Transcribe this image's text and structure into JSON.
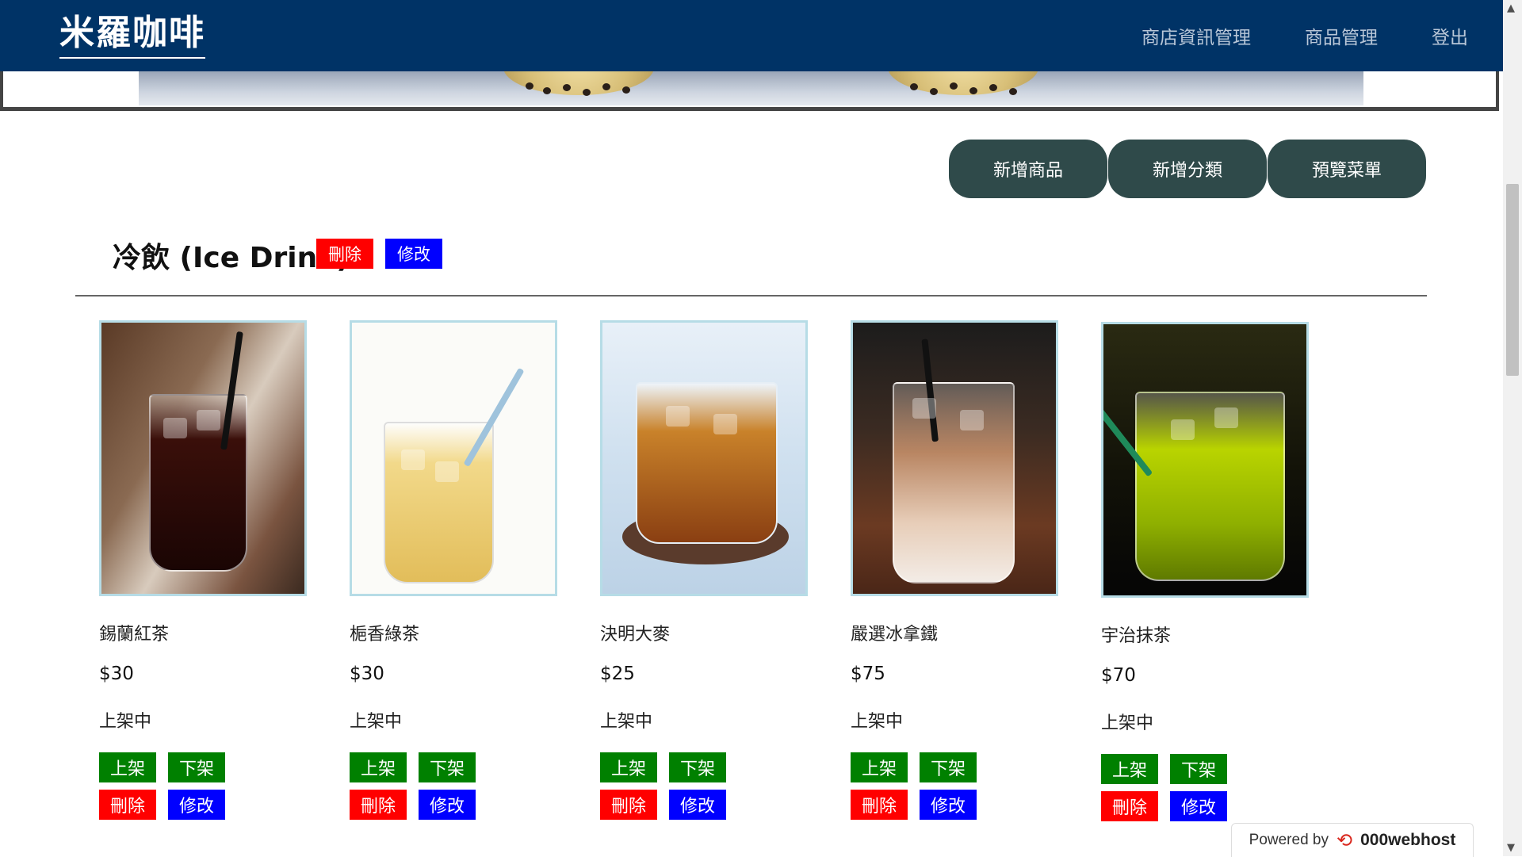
{
  "app": {
    "brand": "米羅咖啡"
  },
  "nav": [
    {
      "label": "商店資訊管理"
    },
    {
      "label": "商品管理"
    },
    {
      "label": "登出"
    }
  ],
  "actions": {
    "add_product": "新增商品",
    "add_category": "新增分類",
    "preview_menu": "預覽菜單"
  },
  "category": {
    "title": "冷飲 (Ice Drink)",
    "delete_label": "刪除",
    "edit_label": "修改"
  },
  "products": [
    {
      "name": "錫蘭紅茶",
      "price": "$30",
      "status": "上架中",
      "list_label": "上架",
      "unlist_label": "下架",
      "delete_label": "刪除",
      "edit_label": "修改"
    },
    {
      "name": "梔香綠茶",
      "price": "$30",
      "status": "上架中",
      "list_label": "上架",
      "unlist_label": "下架",
      "delete_label": "刪除",
      "edit_label": "修改"
    },
    {
      "name": "決明大麥",
      "price": "$25",
      "status": "上架中",
      "list_label": "上架",
      "unlist_label": "下架",
      "delete_label": "刪除",
      "edit_label": "修改"
    },
    {
      "name": "嚴選冰拿鐵",
      "price": "$75",
      "status": "上架中",
      "list_label": "上架",
      "unlist_label": "下架",
      "delete_label": "刪除",
      "edit_label": "修改"
    },
    {
      "name": "宇治抹茶",
      "price": "$70",
      "status": "上架中",
      "list_label": "上架",
      "unlist_label": "下架",
      "delete_label": "刪除",
      "edit_label": "修改"
    }
  ],
  "footer": {
    "powered_by": "Powered by",
    "host": "000webhost"
  },
  "colors": {
    "nav_bg": "#003366",
    "pill_bg": "#2f4a4a",
    "delete": "#ff0000",
    "edit": "#0000ff",
    "list": "#008000"
  }
}
